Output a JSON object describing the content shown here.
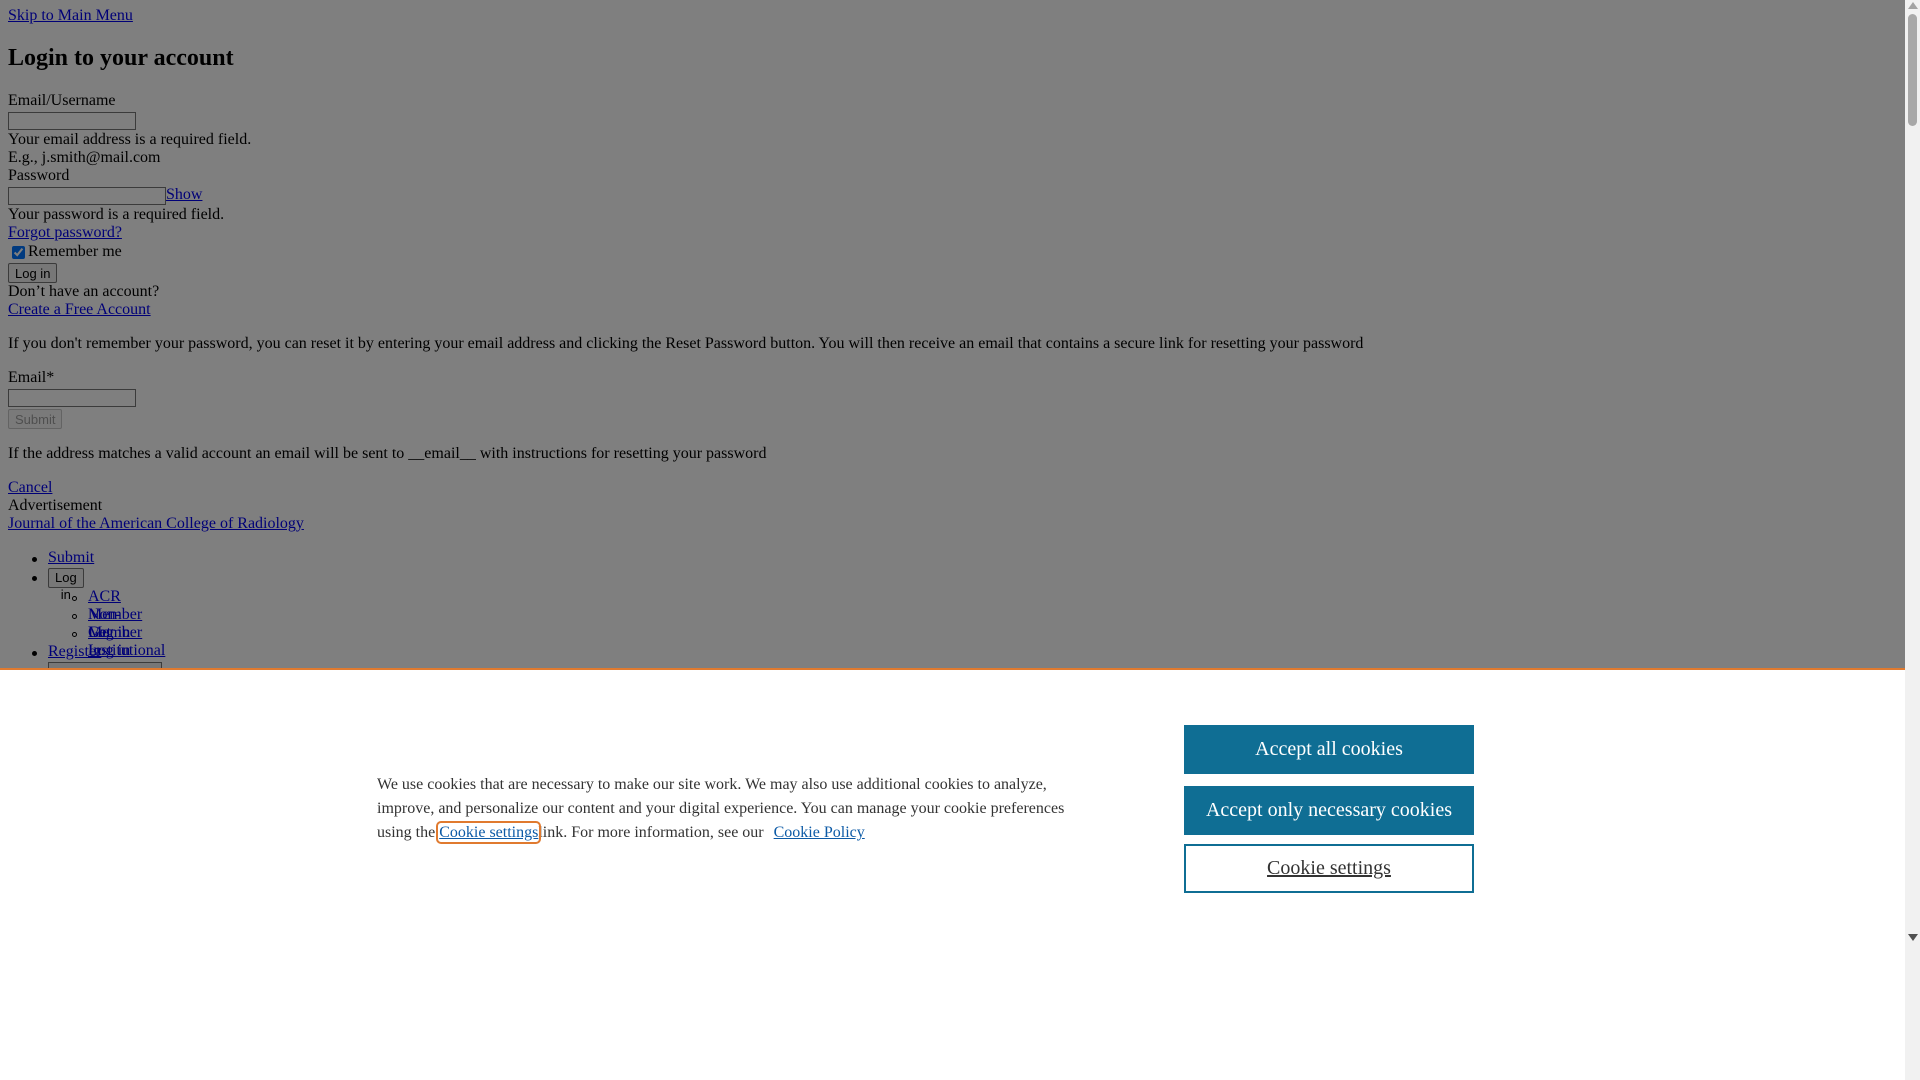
{
  "skip_link": "Skip to Main Menu",
  "login": {
    "title": "Login to your account",
    "email_label": "Email/Username",
    "email_value": "",
    "email_required": "Your email address is a required field.",
    "email_example": "E.g., j.smith@mail.com",
    "password_label": "Password",
    "password_value": "",
    "show_link": "Show",
    "password_required": "Your password is a required field.",
    "forgot_link": "Forgot password?",
    "remember_label": "Remember me",
    "remember_checked": true,
    "login_button": "Log in",
    "no_account_text": "Don’t have an account?",
    "create_link": "Create a Free Account"
  },
  "reset": {
    "instructions": "If you don't remember your password, you can reset it by entering your email address and clicking the Reset Password button. You will then receive an email that contains a secure link for resetting your password",
    "email_label": "Email*",
    "email_value": "",
    "submit_button": "Submit",
    "confirmation": "If the address matches a valid account an email will be sent to __email__ with instructions for resetting your password",
    "cancel_link": "Cancel"
  },
  "advertisement_alt": "Advertisement",
  "journal_logo_alt": "Journal of the American College of Radiology",
  "nav": {
    "submit": "Submit",
    "login_button": "Log in",
    "sub_items": [
      "ACR Member Log in",
      "Non-Member Log in",
      "Get Institutional Access"
    ],
    "register": "Register"
  },
  "cookie_banner": {
    "text_before": "We use cookies that are necessary to make our site work. We may also use additional cookies to analyze, improve, and personalize our content and your digital experience. You can manage your cookie preferences using the",
    "settings_link": "Cookie settings",
    "text_after": "link. For more information, see our",
    "policy_link": "Cookie Policy",
    "accept_all": "Accept all cookies",
    "accept_necessary": "Accept only necessary cookies",
    "settings_button": "Cookie settings",
    "accent_color": "#0f6e94",
    "focus_color": "#e07a2f"
  }
}
